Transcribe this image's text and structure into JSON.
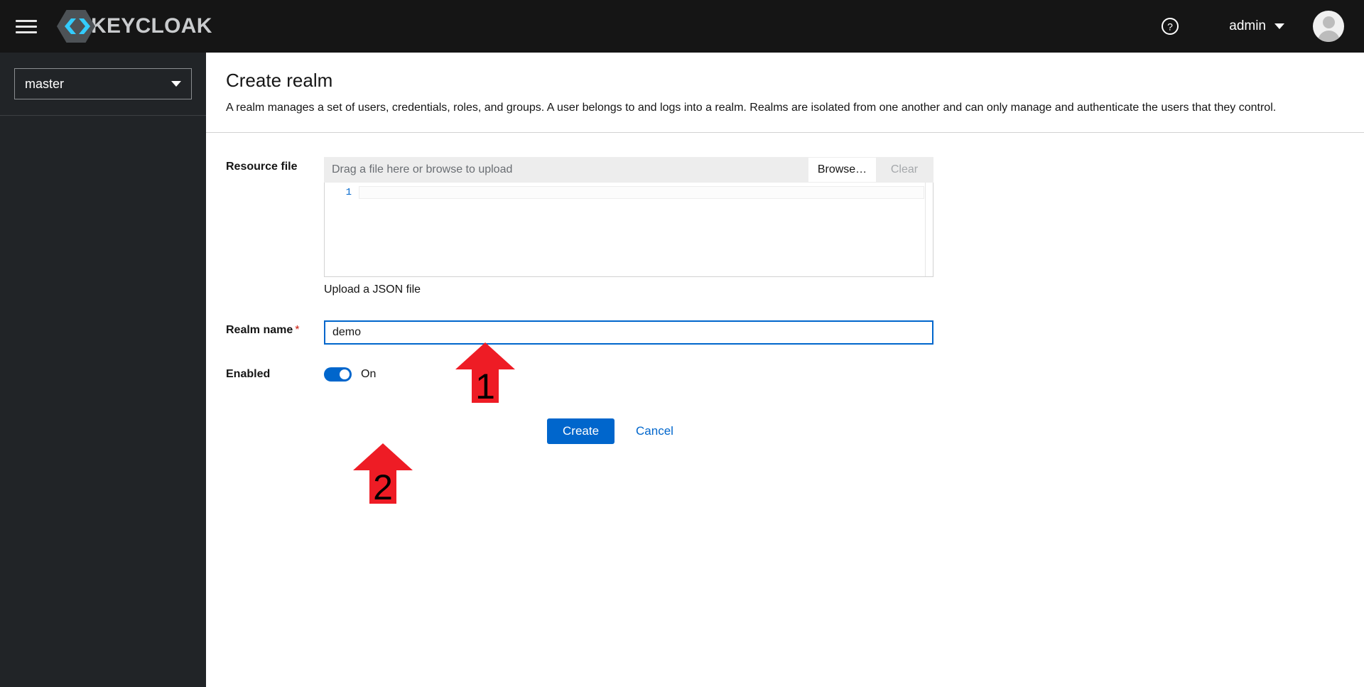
{
  "masthead": {
    "menu_icon": "hamburger-icon",
    "brand_text": "KEYCLOAK",
    "brand_mark_icon": "keycloak-hex-logo-icon",
    "help_icon": "question-circle-icon",
    "user_name": "admin",
    "user_caret_icon": "caret-down-icon",
    "avatar_icon": "user-avatar-icon",
    "brand_accent_color": "#33ccff",
    "masthead_bg": "#151515"
  },
  "sidebar": {
    "realm_selected": "master",
    "realm_caret_icon": "caret-down-icon",
    "bg": "#212427"
  },
  "page": {
    "title": "Create realm",
    "description": "A realm manages a set of users, credentials, roles, and groups. A user belongs to and logs into a realm. Realms are isolated from one another and can only manage and authenticate the users that they control."
  },
  "form": {
    "resource_file": {
      "label": "Resource file",
      "placeholder": "Drag a file here or browse to upload",
      "browse_label": "Browse…",
      "clear_label": "Clear",
      "clear_disabled": true,
      "editor_line_number": "1",
      "editor_value": "",
      "help_text": "Upload a JSON file"
    },
    "realm_name": {
      "label": "Realm name",
      "required_marker": "*",
      "value": "demo",
      "focus_color": "#0066cc"
    },
    "enabled": {
      "label": "Enabled",
      "state_label": "On",
      "on": true,
      "accent_color": "#0066cc"
    },
    "actions": {
      "create_label": "Create",
      "cancel_label": "Cancel",
      "primary_color": "#0066cc"
    }
  },
  "annotations": {
    "color": "#ee1c25",
    "items": [
      {
        "number": "1",
        "target": "realm-name-input"
      },
      {
        "number": "2",
        "target": "create-button"
      }
    ]
  }
}
